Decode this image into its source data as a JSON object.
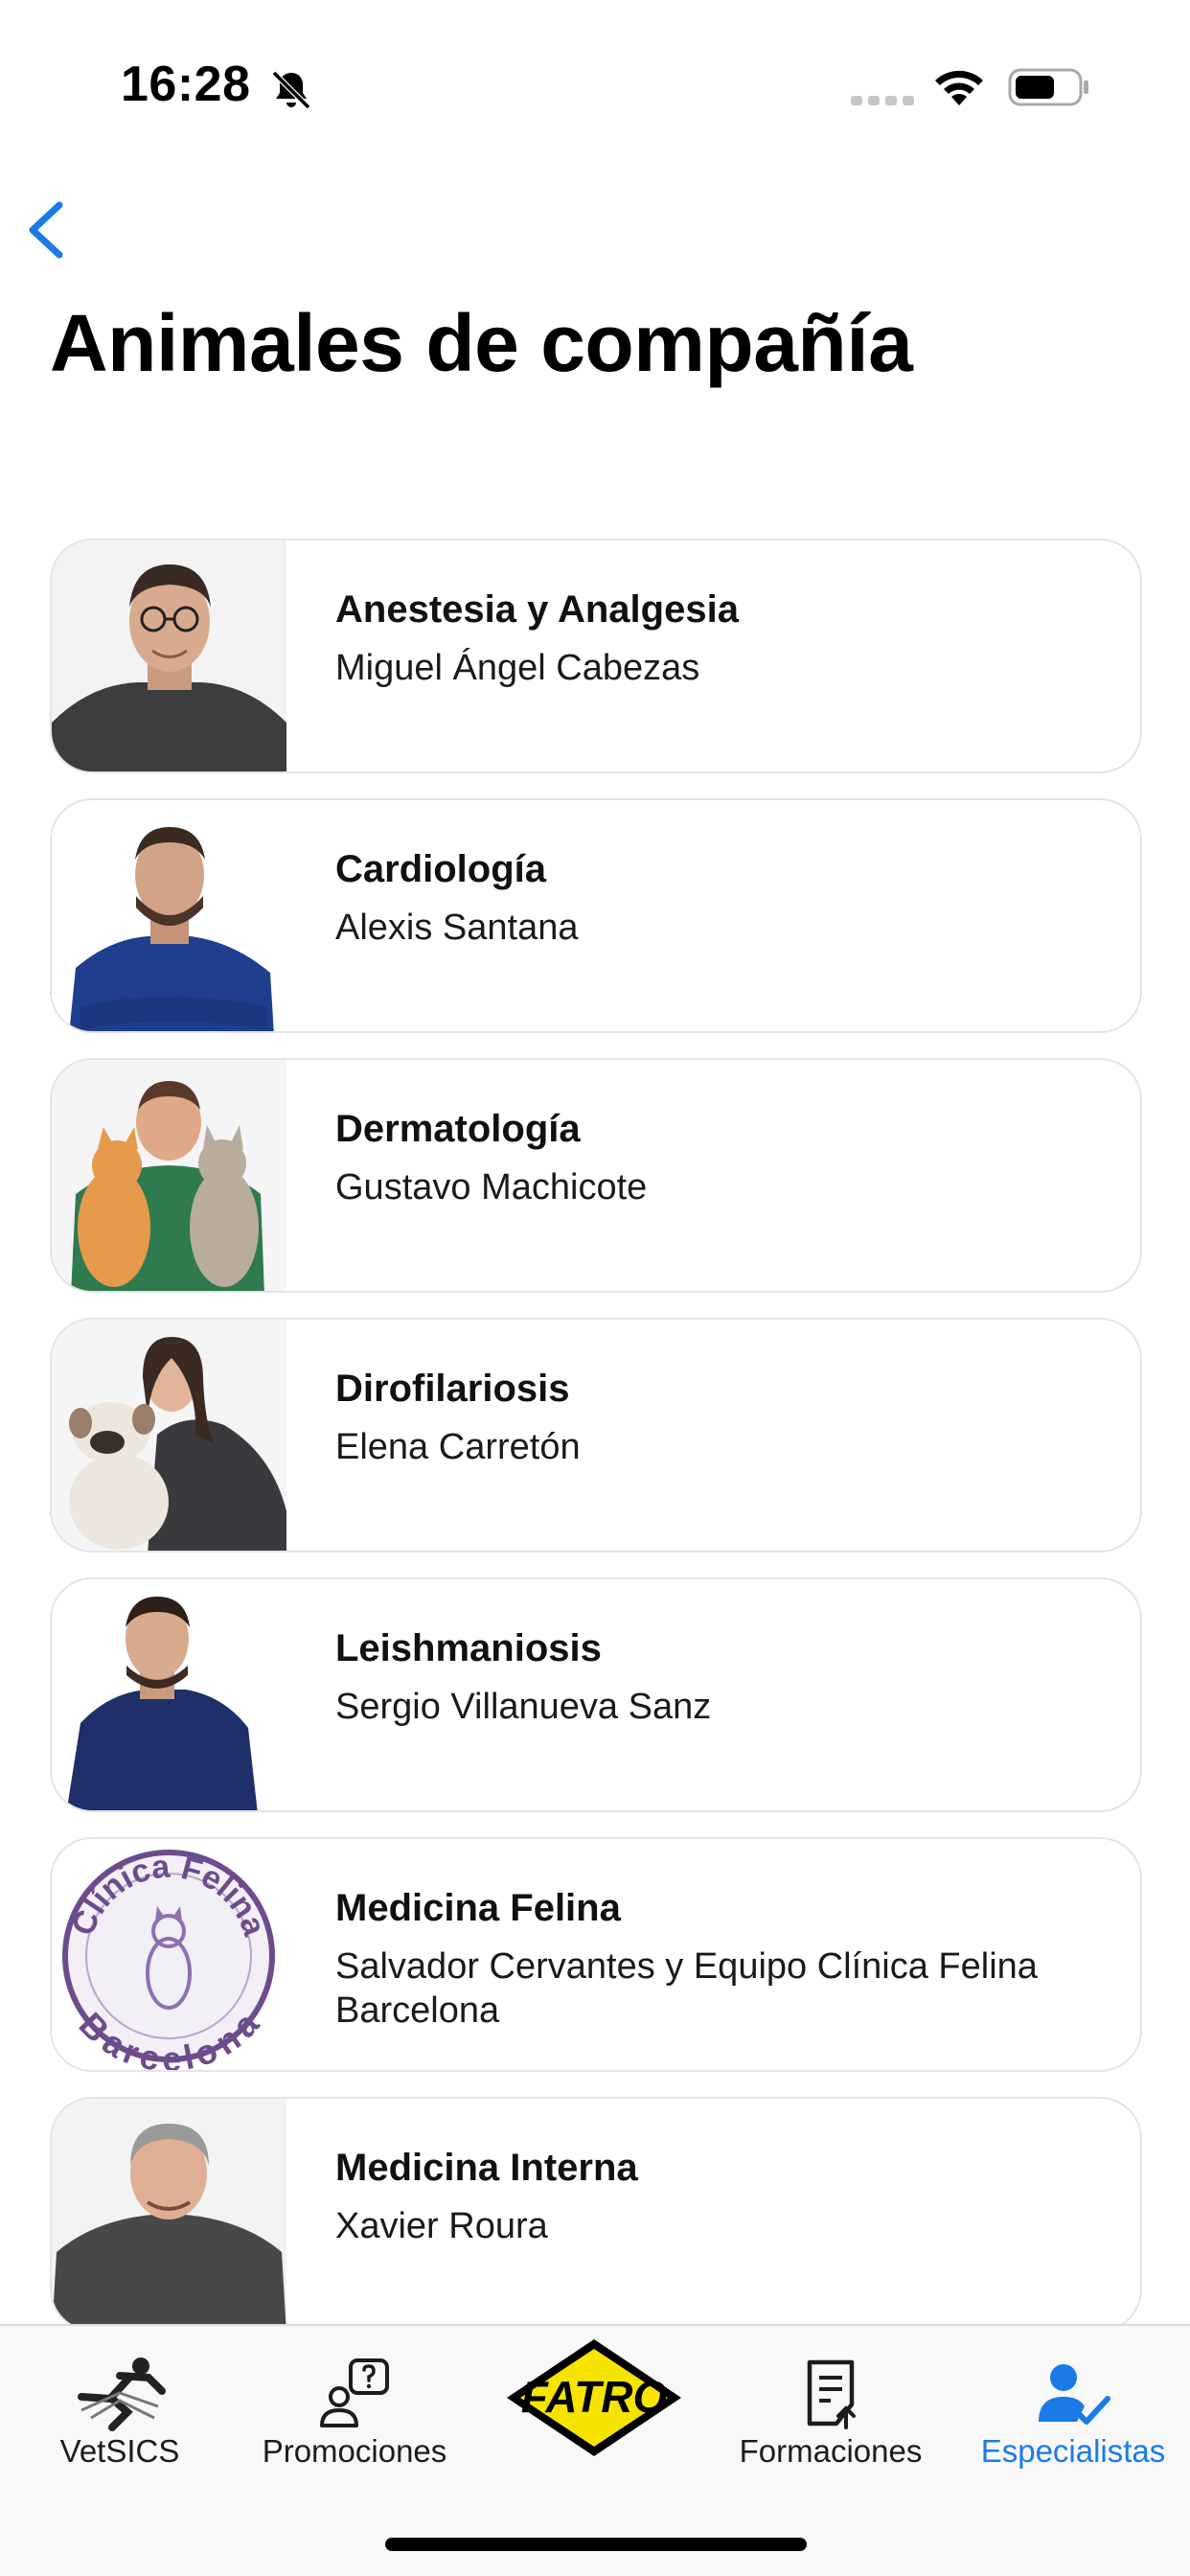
{
  "status_bar": {
    "time": "16:28",
    "icons": [
      "bell-slash-icon",
      "cellular-signal-icon",
      "wifi-icon",
      "battery-icon"
    ]
  },
  "header": {
    "back_icon": "chevron-left-icon",
    "title": "Animales de compañía"
  },
  "specialists": [
    {
      "specialty": "Anestesia y Analgesia",
      "name": "Miguel Ángel Cabezas",
      "photo": "man-glasses-gray-scrubs"
    },
    {
      "specialty": "Cardiología",
      "name": "Alexis Santana",
      "photo": "man-beard-navy-scrubs"
    },
    {
      "specialty": "Dermatología",
      "name": "Gustavo Machicote",
      "photo": "man-holding-two-cats"
    },
    {
      "specialty": "Dirofilariosis",
      "name": "Elena Carretón",
      "photo": "woman-with-bulldog"
    },
    {
      "specialty": "Leishmaniosis",
      "name": "Sergio Villanueva Sanz",
      "photo": "man-navy-scrubs"
    },
    {
      "specialty": "Medicina Felina",
      "name": "Salvador Cervantes y Equipo Clínica Felina Barcelona",
      "photo": "clinica-felina-logo",
      "logo_text_top": "Clínica Felina",
      "logo_text_bottom": "Barcelona"
    },
    {
      "specialty": "Medicina Interna",
      "name": "Xavier Roura",
      "photo": "man-gray-sweater"
    }
  ],
  "tab_bar": {
    "tabs": [
      {
        "label": "VetSICS",
        "icon": "runner-icon",
        "active": false
      },
      {
        "label": "Promociones",
        "icon": "person-question-icon",
        "active": false
      },
      {
        "label": "",
        "icon": "fatro-logo",
        "logo_text": "FATRO",
        "active": false
      },
      {
        "label": "Formaciones",
        "icon": "document-upload-icon",
        "active": false
      },
      {
        "label": "Especialistas",
        "icon": "person-check-icon",
        "active": true
      }
    ]
  },
  "colors": {
    "accent": "#1a7ae8",
    "card_border": "#e3e3e8",
    "tab_bar_bg": "#f8f8f8",
    "fatro_yellow": "#f5e400"
  }
}
